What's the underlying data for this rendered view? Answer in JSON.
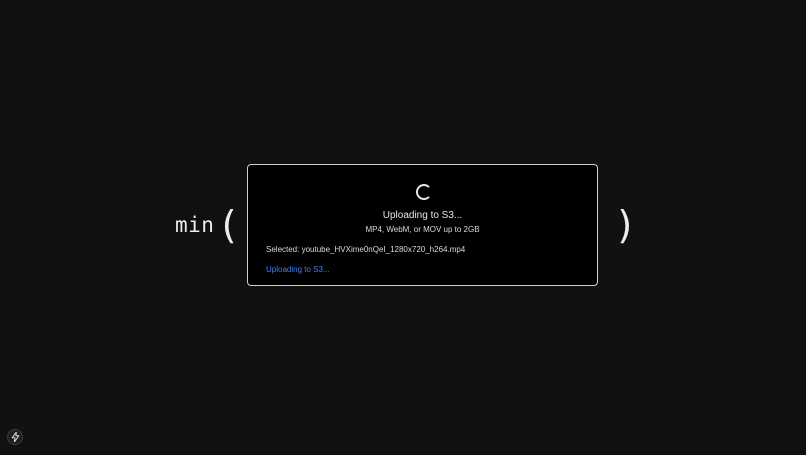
{
  "expression": {
    "word": "min",
    "open_paren": "(",
    "close_paren": ")"
  },
  "upload_card": {
    "status_title": "Uploading to S3...",
    "format_hint": "MP4, WebM, or MOV up to 2GB",
    "selected_file": "Selected: youtube_HVXime0nQeI_1280x720_h264.mp4",
    "progress_text": "Uploading to S3..."
  },
  "colors": {
    "background": "#111111",
    "card_background": "#000000",
    "card_border": "#cfcfcf",
    "progress_text": "#3b82f6"
  },
  "icons": {
    "spinner": "loading-spinner-icon",
    "dev_badge": "lightning-bolt-icon"
  }
}
